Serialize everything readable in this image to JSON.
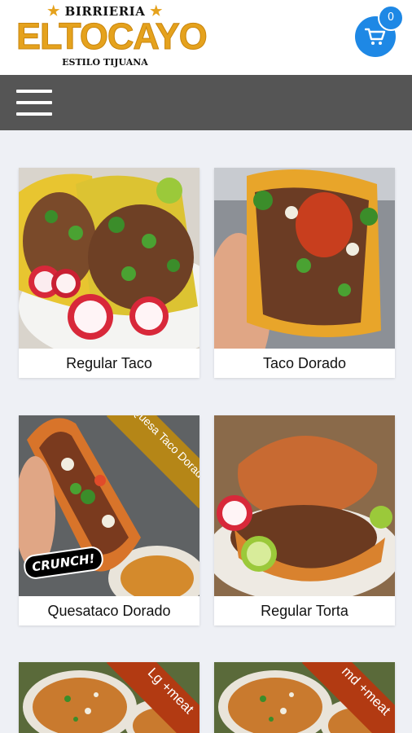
{
  "header": {
    "logo_top": "BIRRIERIA",
    "logo_main": "ELTOCAYO",
    "logo_sub": "ESTILO TIJUANA",
    "cart_count": "0",
    "accent": "#1e88e5",
    "logo_color": "#e5a21d"
  },
  "nav": {
    "menu_icon": "hamburger-icon",
    "bar_color": "#555555"
  },
  "menu": {
    "items": [
      {
        "label": "Regular Taco"
      },
      {
        "label": "Taco Dorado"
      },
      {
        "label": "Quesataco Dorado",
        "ribbon": "Quesa Taco Dorado",
        "sticker": "CRUNCH!"
      },
      {
        "label": "Regular Torta"
      },
      {
        "ribbon": "Lg +meat"
      },
      {
        "ribbon": "md +meat"
      }
    ]
  }
}
